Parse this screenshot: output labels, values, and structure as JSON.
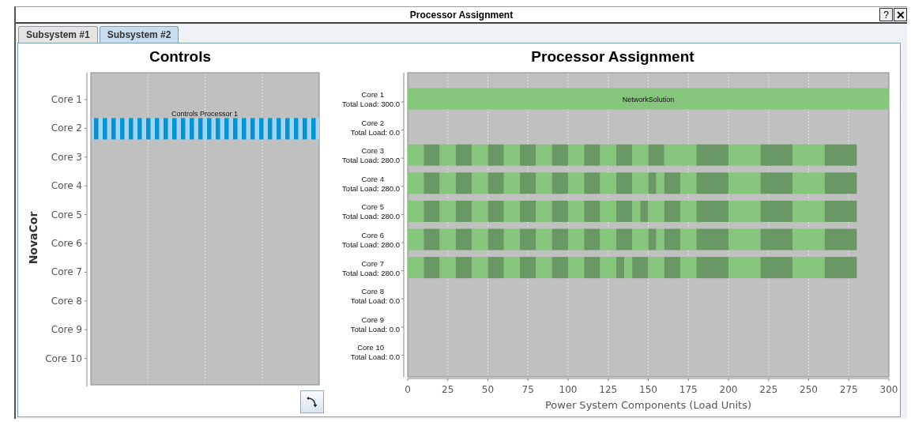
{
  "window": {
    "title": "Processor Assignment",
    "buttons": [
      "?",
      "✕"
    ]
  },
  "tabs": [
    {
      "label": "Subsystem #1",
      "selected": false
    },
    {
      "label": "Subsystem #2",
      "selected": true
    }
  ],
  "controls_chart": {
    "title": "Controls",
    "ylabel": "NovaCor",
    "rows": [
      {
        "label": "Core 1"
      },
      {
        "label": "Core 2",
        "bar": "Controls Processor 1"
      },
      {
        "label": "Core 3"
      },
      {
        "label": "Core 4"
      },
      {
        "label": "Core 5"
      },
      {
        "label": "Core 6"
      },
      {
        "label": "Core 7"
      },
      {
        "label": "Core 8"
      },
      {
        "label": "Core 9"
      },
      {
        "label": "Core 10"
      }
    ]
  },
  "processor_chart": {
    "title": "Processor Assignment",
    "chart_data": {
      "type": "bar",
      "orientation": "horizontal",
      "stacked": true,
      "xlabel": "Power System Components (Load Units)",
      "xlim": [
        0,
        300
      ],
      "xticks": [
        0,
        25,
        50,
        75,
        100,
        125,
        150,
        175,
        200,
        225,
        250,
        275,
        300
      ],
      "categories": [
        "Core 1\nTotal Load: 300.0",
        "Core 2\nTotal Load: 0.0",
        "Core 3\nTotal Load: 280.0",
        "Core 4\nTotal Load: 280.0",
        "Core 5\nTotal Load: 280.0",
        "Core 6\nTotal Load: 280.0",
        "Core 7\nTotal Load: 280.0",
        "Core 8\nTotal Load: 0.0",
        "Core 9\nTotal Load: 0.0",
        "Core 10\nTotal Load: 0.0"
      ],
      "series": [
        {
          "color": "#86c67c",
          "values": [
            300,
            null,
            10,
            10,
            10,
            10,
            10,
            null,
            null,
            null
          ]
        },
        {
          "color": "#699864",
          "values": [
            null,
            null,
            10,
            10,
            10,
            10,
            10,
            null,
            null,
            null
          ]
        },
        {
          "color": "#86c67c",
          "values": [
            null,
            null,
            10,
            10,
            10,
            10,
            10,
            null,
            null,
            null
          ]
        },
        {
          "color": "#699864",
          "values": [
            null,
            null,
            10,
            10,
            10,
            10,
            10,
            null,
            null,
            null
          ]
        },
        {
          "color": "#86c67c",
          "values": [
            null,
            null,
            10,
            10,
            10,
            10,
            10,
            null,
            null,
            null
          ]
        },
        {
          "color": "#699864",
          "values": [
            null,
            null,
            10,
            10,
            10,
            10,
            10,
            null,
            null,
            null
          ]
        },
        {
          "color": "#86c67c",
          "values": [
            null,
            null,
            10,
            10,
            10,
            10,
            10,
            null,
            null,
            null
          ]
        },
        {
          "color": "#699864",
          "values": [
            null,
            null,
            10,
            10,
            10,
            10,
            10,
            null,
            null,
            null
          ]
        },
        {
          "color": "#86c67c",
          "values": [
            null,
            null,
            10,
            10,
            10,
            10,
            10,
            null,
            null,
            null
          ]
        },
        {
          "color": "#699864",
          "values": [
            null,
            null,
            10,
            10,
            10,
            10,
            10,
            null,
            null,
            null
          ]
        },
        {
          "color": "#86c67c",
          "values": [
            null,
            null,
            10,
            10,
            10,
            10,
            10,
            null,
            null,
            null
          ]
        },
        {
          "color": "#699864",
          "values": [
            null,
            null,
            10,
            10,
            10,
            10,
            10,
            null,
            null,
            null
          ]
        },
        {
          "color": "#86c67c",
          "values": [
            null,
            null,
            10,
            10,
            10,
            10,
            10,
            null,
            null,
            null
          ]
        },
        {
          "color": "#699864",
          "values": [
            null,
            null,
            10,
            10,
            10,
            10,
            5,
            null,
            null,
            null
          ]
        },
        {
          "color": "#86c67c",
          "values": [
            null,
            null,
            10,
            10,
            5,
            10,
            5,
            null,
            null,
            null
          ]
        },
        {
          "color": "#699864",
          "values": [
            null,
            null,
            10,
            5,
            5,
            5,
            10,
            null,
            null,
            null
          ]
        },
        {
          "color": "#86c67c",
          "values": [
            null,
            null,
            20,
            5,
            10,
            5,
            10,
            null,
            null,
            null
          ]
        },
        {
          "color": "#699864",
          "values": [
            null,
            null,
            20,
            10,
            10,
            10,
            10,
            null,
            null,
            null
          ]
        },
        {
          "color": "#86c67c",
          "values": [
            null,
            null,
            20,
            10,
            10,
            10,
            10,
            null,
            null,
            null
          ]
        },
        {
          "color": "#699864",
          "values": [
            null,
            null,
            20,
            20,
            20,
            20,
            20,
            null,
            null,
            null
          ]
        },
        {
          "color": "#86c67c",
          "values": [
            null,
            null,
            20,
            20,
            20,
            20,
            20,
            null,
            null,
            null
          ]
        },
        {
          "color": "#699864",
          "values": [
            null,
            null,
            20,
            20,
            20,
            20,
            20,
            null,
            null,
            null
          ]
        },
        {
          "color": "#86c67c",
          "values": [
            null,
            null,
            null,
            20,
            20,
            20,
            20,
            null,
            null,
            null
          ]
        },
        {
          "color": "#699864",
          "values": [
            null,
            null,
            null,
            20,
            20,
            20,
            20,
            null,
            null,
            null
          ]
        }
      ],
      "grid": true,
      "annotations": [
        {
          "text": "NetworkSolution",
          "x": 150,
          "y": "Core 1\nTotal Load: 300.0"
        }
      ]
    }
  }
}
